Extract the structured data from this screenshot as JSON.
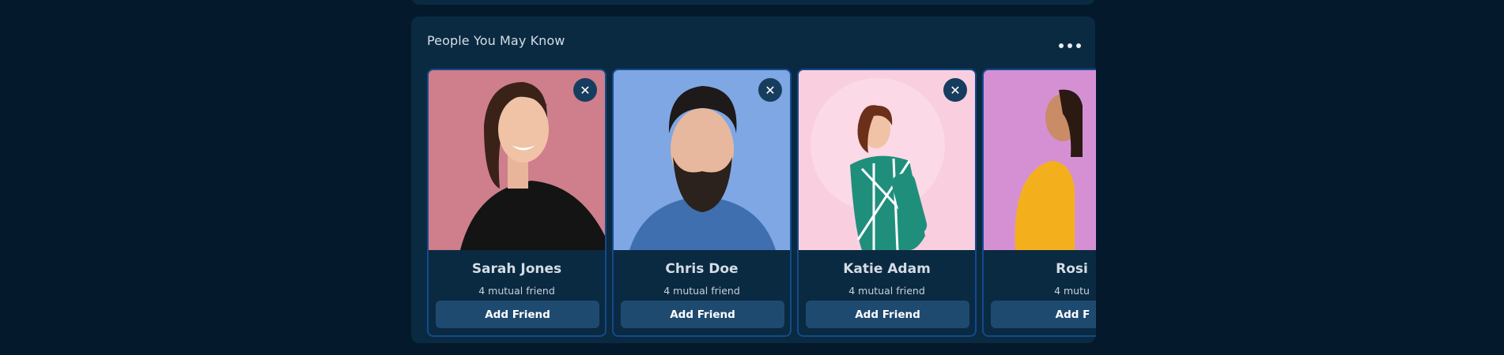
{
  "section": {
    "title": "People You May Know",
    "more_icon": "ellipsis-horizontal-icon"
  },
  "colors": {
    "page_background": "#041a2c",
    "panel_background": "#0a2a42",
    "card_border": "#134a8c",
    "button_background": "#1f4a70",
    "dismiss_background": "#173d5e"
  },
  "suggestions": [
    {
      "name": "Sarah Jones",
      "mutual": "4 mutual friend",
      "action": "Add Friend",
      "dismiss": "✕",
      "photo_bg": "#cf7e8b"
    },
    {
      "name": "Chris Doe",
      "mutual": "4 mutual friend",
      "action": "Add Friend",
      "dismiss": "✕",
      "photo_bg": "#7fa7e4"
    },
    {
      "name": "Katie Adam",
      "mutual": "4 mutual friend",
      "action": "Add Friend",
      "dismiss": "✕",
      "photo_bg": "#f9cfe0"
    },
    {
      "name": "Rosi",
      "mutual": "4 mutu",
      "action": "Add F",
      "dismiss": "✕",
      "photo_bg": "#d590d4"
    }
  ]
}
